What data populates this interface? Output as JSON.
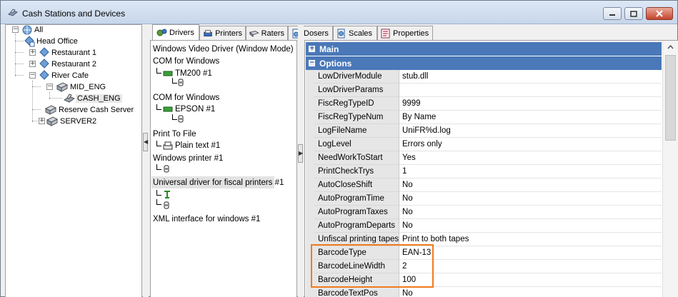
{
  "window": {
    "title": "Cash Stations and Devices"
  },
  "tree": {
    "items": [
      {
        "label": "All"
      },
      {
        "label": "Head Office"
      },
      {
        "label": "Restaurant 1"
      },
      {
        "label": "Restaurant 2"
      },
      {
        "label": "River Cafe"
      },
      {
        "label": "MID_ENG"
      },
      {
        "label": "CASH_ENG"
      },
      {
        "label": "Reserve Cash Server"
      },
      {
        "label": "SERVER2"
      }
    ]
  },
  "tabs": [
    {
      "label": "Drivers",
      "icon": "drivers-icon"
    },
    {
      "label": "Printers",
      "icon": "printer-icon"
    },
    {
      "label": "Raters",
      "icon": "scanner-icon"
    },
    {
      "label": "Dosers",
      "icon": "doser-icon"
    },
    {
      "label": "Scales",
      "icon": "scales-icon"
    },
    {
      "label": "Properties",
      "icon": "properties-icon"
    }
  ],
  "drivers": {
    "groups": [
      {
        "label": "Windows Video Driver (Window Mode)"
      },
      {
        "label": "COM for Windows",
        "child": "TM200 #1"
      },
      {
        "label": "COM for Windows",
        "child": "EPSON #1"
      },
      {
        "label": "Print To File",
        "child": "Plain text #1"
      },
      {
        "label": "Windows printer #1"
      },
      {
        "label": "Universal driver for fiscal printers #1"
      },
      {
        "label": "XML interface for windows #1"
      }
    ]
  },
  "properties": {
    "sections": [
      {
        "label": "Main"
      },
      {
        "label": "Options"
      }
    ],
    "rows": [
      {
        "name": "LowDriverModule",
        "value": "stub.dll"
      },
      {
        "name": "LowDriverParams",
        "value": ""
      },
      {
        "name": "FiscRegTypeID",
        "value": "9999"
      },
      {
        "name": "FiscRegTypeNum",
        "value": "By Name"
      },
      {
        "name": "LogFileName",
        "value": "UniFR%d.log"
      },
      {
        "name": "LogLevel",
        "value": "Errors only"
      },
      {
        "name": "NeedWorkToStart",
        "value": "Yes"
      },
      {
        "name": "PrintCheckTrys",
        "value": "1"
      },
      {
        "name": "AutoCloseShift",
        "value": "No"
      },
      {
        "name": "AutoProgramTime",
        "value": "No"
      },
      {
        "name": "AutoProgramTaxes",
        "value": "No"
      },
      {
        "name": "AutoProgramDeparts",
        "value": "No"
      },
      {
        "name": "Unfiscal printing tapes",
        "value": "Print to both tapes"
      },
      {
        "name": "BarcodeType",
        "value": "EAN-13"
      },
      {
        "name": "BarcodeLineWidth",
        "value": "2"
      },
      {
        "name": "BarcodeHeight",
        "value": "100"
      },
      {
        "name": "BarcodeTextPos",
        "value": "No"
      }
    ]
  },
  "colors": {
    "section_header": "#4a78b8",
    "highlight": "#f07b1e"
  }
}
